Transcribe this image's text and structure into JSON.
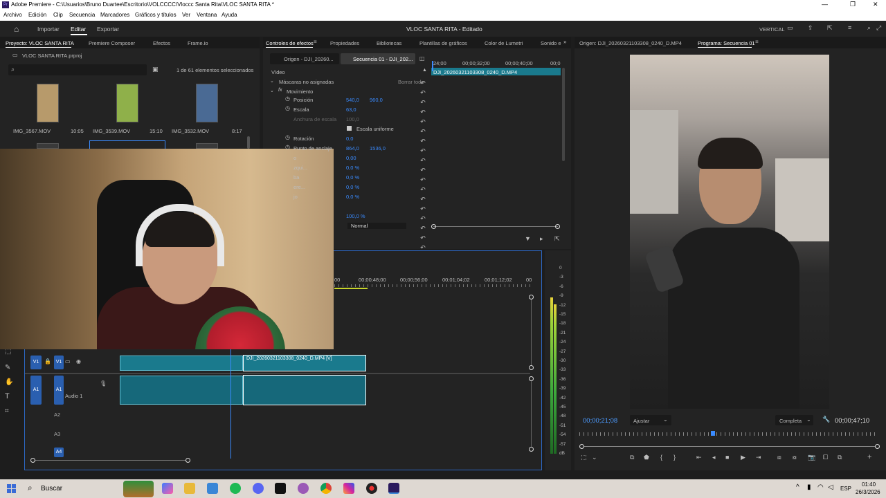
{
  "window": {
    "title": "Adobe Premiere - C:\\Usuarios\\Bruno Duartee\\Escritorio\\VOLCCCC\\Vloccc Santa Rita\\VLOC SANTA RITA *",
    "controls": [
      "—",
      "❐",
      "✕"
    ]
  },
  "menu": [
    "Archivo",
    "Edición",
    "Clip",
    "Secuencia",
    "Marcadores",
    "Gráficos y títulos",
    "Ver",
    "Ventana",
    "Ayuda"
  ],
  "appbar": {
    "tabs": [
      "Importar",
      "Editar",
      "Exportar"
    ],
    "active": "Editar",
    "project_title": "VLOC SANTA RITA - Editado",
    "layout": "VERTICAL"
  },
  "project": {
    "tabs": [
      "Proyecto: VLOC SANTA RITA",
      "Premiere Composer",
      "Efectos",
      "Frame.io"
    ],
    "file": "VLOC SANTA RITA.prproj",
    "selection": "1 de 61 elementos seleccionados",
    "clips": [
      {
        "name": "IMG_3567.MOV",
        "duration": "10:05",
        "color": "#b79a6b"
      },
      {
        "name": "IMG_3539.MOV",
        "duration": "15:10",
        "color": "#8fb04a"
      },
      {
        "name": "IMG_3532.MOV",
        "duration": "8:17",
        "color": "#4a6a94"
      }
    ]
  },
  "effects": {
    "tabs": [
      "Controles de efectos",
      "Propiedades",
      "Bibliotecas",
      "Plantillas de gráficos",
      "Color de Lumetri",
      "Sonido e"
    ],
    "source_tab": "Origen - DJI_20260...",
    "sequence_tab": "Secuencia 01 - DJI_202...",
    "section": "Vídeo",
    "masks": "Máscaras no asignadas",
    "clear": "Borrar todo",
    "motion": "Movimiento",
    "props": [
      {
        "label": "Posición",
        "v1": "540,0",
        "v2": "960,0"
      },
      {
        "label": "Escala",
        "v1": "63,0",
        "v2": ""
      },
      {
        "label": "Anchura de escala",
        "v1": "100,0",
        "v2": ""
      },
      {
        "label": "Escala uniforme",
        "v1": "",
        "v2": ""
      },
      {
        "label": "Rotación",
        "v1": "0,0",
        "v2": ""
      },
      {
        "label": "Punto de anclaje",
        "v1": "864,0",
        "v2": "1536,0"
      },
      {
        "label": "o",
        "v1": "0,00",
        "v2": ""
      },
      {
        "label": "zqui...",
        "v1": "0,0 %",
        "v2": ""
      },
      {
        "label": "ba",
        "v1": "0,0 %",
        "v2": ""
      },
      {
        "label": "ere...",
        "v1": "0,0 %",
        "v2": ""
      },
      {
        "label": "jo",
        "v1": "0,0 %",
        "v2": ""
      },
      {
        "label": "",
        "v1": "",
        "v2": ""
      },
      {
        "label": "",
        "v1": "100,0 %",
        "v2": ""
      },
      {
        "label": "",
        "v1": "Normal",
        "v2": ""
      }
    ],
    "ruler": [
      "24;00",
      "00;00;32;00",
      "00;00;40;00",
      "00;0"
    ],
    "clipname": "DJI_20260321103308_0240_D.MP4"
  },
  "timeline": {
    "ruler": [
      "00",
      "00;00;48;00",
      "00;00;56;00",
      "00;01;04;02",
      "00;01;12;02",
      "00"
    ],
    "clip_label": "DJI_20260321103308_0240_D.MP4 [V]",
    "tracks": [
      {
        "name": "V1"
      },
      {
        "name": "A1",
        "label": "Audio 1"
      },
      {
        "name": "A2"
      },
      {
        "name": "A3"
      },
      {
        "name": "A4"
      }
    ]
  },
  "meter": {
    "scale": [
      "0",
      "-3",
      "-6",
      "-9",
      "-12",
      "-15",
      "-18",
      "-21",
      "-24",
      "-27",
      "-30",
      "-33",
      "-36",
      "-39",
      "-42",
      "-45",
      "-48",
      "-51",
      "-54",
      "-57",
      "dB"
    ]
  },
  "program": {
    "tabs": [
      "Origen: DJI_20260321103308_0240_D.MP4",
      "Programa: Secuencia 01"
    ],
    "timecode": "00;00;21;08",
    "fit": "Ajustar",
    "quality": "Completa",
    "duration": "00;00;47;10"
  },
  "taskbar": {
    "search": "Buscar",
    "lang": "ESP",
    "time": "01:40",
    "date": "26/3/2026"
  }
}
